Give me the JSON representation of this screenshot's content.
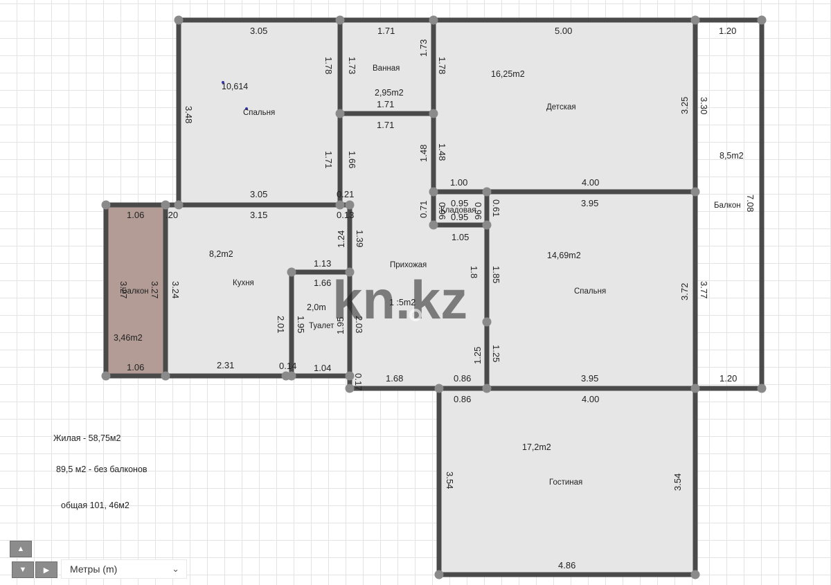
{
  "watermark": "kn.kz",
  "rooms": {
    "bathroom": {
      "name": "Ванная",
      "area": "2,95m2"
    },
    "bedroom_nw": {
      "name": "Спальня",
      "area": "10,614"
    },
    "kids": {
      "name": "Детская",
      "area": "16,25m2"
    },
    "balcony_east": {
      "name": "Балкон",
      "area": "8,5m2"
    },
    "kitchen": {
      "name": "Кухня",
      "area": "8,2m2"
    },
    "balcony_west": {
      "name": "Балкон",
      "area": "3,46m2"
    },
    "toilet": {
      "name": "Туалет",
      "area": "2,0m"
    },
    "hall": {
      "name": "Прихожая",
      "area": "1 :5m2"
    },
    "storage": {
      "name": "Кладовая"
    },
    "bedroom_se": {
      "name": "Спальня",
      "area": "14,69m2"
    },
    "living": {
      "name": "Гостиная",
      "area": "17,2m2"
    }
  },
  "dims": [
    "3.05",
    "1.71",
    "5.00",
    "1.20",
    "1.78",
    "1.73",
    "1.73",
    "1.78",
    "1.71",
    "1.71",
    "3.48",
    "3.25",
    "3.30",
    "1.71",
    "1.66",
    "1.48",
    "1.48",
    "3.05",
    "0.21",
    "1.00",
    "4.00",
    "7.08",
    "1.06",
    ".20",
    "3.15",
    "0.13",
    "0.95",
    "0.95",
    "0.96",
    "0.96",
    "0.71",
    "0.61",
    "3.95",
    "1.24",
    "1.39",
    "1.05",
    "1.13",
    "1.66",
    "3.27",
    "3.27",
    "3.24",
    "1.85",
    "1.8",
    "3.72",
    "3.77",
    "2.01",
    "1.95",
    "1.95",
    "2.03",
    "1.25",
    "1.25",
    "1.06",
    "2.31",
    "0.14",
    "1.04",
    "0.17",
    "1.68",
    "0.86",
    "3.95",
    "1.20",
    "0.86",
    "4.00",
    "3.54",
    "3.54",
    "4.86"
  ],
  "summary": {
    "living_area": "Жилая - 58,75м2",
    "without_balconies": "89,5 м2 - без балконов",
    "total": "общая 101, 46м2"
  },
  "controls": {
    "up": "▲",
    "down": "▼",
    "right": "▶",
    "units_label": "Метры (m)",
    "units_chevron": "⌄"
  },
  "colors": {
    "wall": "#4a4a4a",
    "floor": "#e6e6e6",
    "balcony_fill": "#b29c95",
    "node": "#8a8a8a"
  }
}
